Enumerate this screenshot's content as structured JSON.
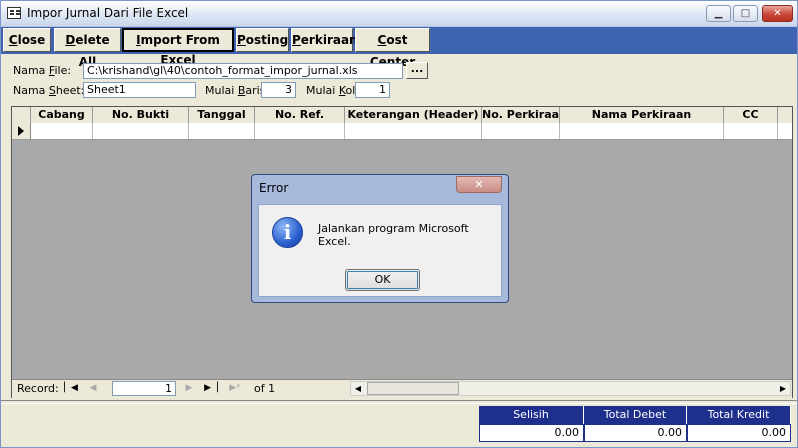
{
  "window": {
    "title": "Impor Jurnal Dari File Excel",
    "minimize": "▁",
    "maximize": "□",
    "close": "✕"
  },
  "toolbar": {
    "close": {
      "pre": "",
      "key": "C",
      "post": "lose"
    },
    "delete_all": {
      "pre": "",
      "key": "D",
      "post": "elete All"
    },
    "import": {
      "pre": "",
      "key": "I",
      "post": "mport From Excel"
    },
    "posting": {
      "pre": "",
      "key": "P",
      "post": "osting"
    },
    "perkiraan": {
      "pre": "",
      "key": "P",
      "post": "erkiraan"
    },
    "cost_center": {
      "pre": "",
      "key": "C",
      "post": "ost Center"
    }
  },
  "form": {
    "file_label": {
      "pre": "Nama ",
      "key": "F",
      "post": "ile:"
    },
    "file_value": "C:\\krishand\\gl\\40\\contoh_format_impor_jurnal.xls",
    "browse": "...",
    "sheet_label": {
      "pre": "Nama ",
      "key": "S",
      "post": "heet:"
    },
    "sheet_value": "Sheet1",
    "baris_label": {
      "pre": "Mulai ",
      "key": "B",
      "post": "aris:"
    },
    "baris_value": "3",
    "kolom_label": {
      "pre": "Mulai ",
      "key": "K",
      "post": "olom:"
    },
    "kolom_value": "1"
  },
  "grid": {
    "columns": [
      "Cabang",
      "No. Bukti",
      "Tanggal",
      "No. Ref.",
      "Keterangan (Header)",
      "No. Perkiraan",
      "Nama Perkiraan",
      "CC"
    ]
  },
  "nav": {
    "record_label": "Record:",
    "first": "▏◀",
    "prev": "◀",
    "current": "1",
    "next": "▶",
    "last": "▶▕",
    "new": "▶*",
    "of_label": "of  1",
    "scroll_left": "◀",
    "scroll_right": "▶"
  },
  "dialog": {
    "title": "Error",
    "close": "✕",
    "icon": "i",
    "message": "Jalankan program Microsoft Excel.",
    "ok": "OK"
  },
  "totals": {
    "headers": [
      "Selisih",
      "Total Debet",
      "Total Kredit"
    ],
    "values": [
      "0.00",
      "0.00",
      "0.00"
    ]
  }
}
